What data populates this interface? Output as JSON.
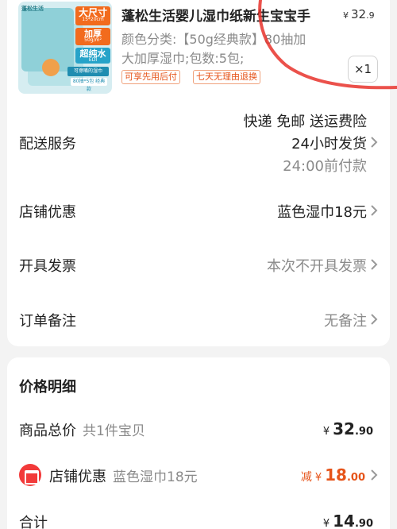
{
  "product": {
    "title": "蓬松生活婴儿湿巾纸新生宝宝手",
    "price_symbol": "¥",
    "price_int": "32",
    "price_dec": ".9",
    "spec_line1": "颜色分类:【50g经典款】80抽加",
    "spec_line2": "大加厚湿巾;包数:5包;",
    "badges": [
      "可享先用后付",
      "七天无理由退换"
    ],
    "quantity": "×1",
    "thumb": {
      "brand": "蓬松生活",
      "tag1": "大尺寸",
      "tag1_sub": "15*20cm",
      "tag2": "加厚",
      "tag2_sub": "50g/m²",
      "tag3": "超纯水",
      "tag3_sub": "EDI",
      "strip": "可擦嘴的湿巾",
      "strip2": "80抽*5包 经典款"
    }
  },
  "delivery": {
    "label": "配送服务",
    "line1": "快递 免邮 送运费险",
    "line2": "24小时发货",
    "line3": "24:00前付款"
  },
  "shop_discount": {
    "label": "店铺优惠",
    "value": "蓝色湿巾18元"
  },
  "invoice": {
    "label": "开具发票",
    "value": "本次不开具发票"
  },
  "note": {
    "label": "订单备注",
    "value": "无备注"
  },
  "price_detail": {
    "title": "价格明细",
    "goods_total_label": "商品总价",
    "goods_total_sub": "共1件宝贝",
    "goods_total_symbol": "¥",
    "goods_total_int": "32",
    "goods_total_dec": ".90",
    "shop_discount_label": "店铺优惠",
    "shop_discount_sub": "蓝色湿巾18元",
    "discount_prefix": "减",
    "discount_symbol": "¥",
    "discount_int": "18",
    "discount_dec": ".00",
    "total_label": "合计",
    "total_symbol": "¥",
    "total_int": "14",
    "total_dec": ".90"
  },
  "colors": {
    "accent": "#e6541a",
    "muted": "#8a8a8a",
    "scribble": "#e8322b"
  }
}
